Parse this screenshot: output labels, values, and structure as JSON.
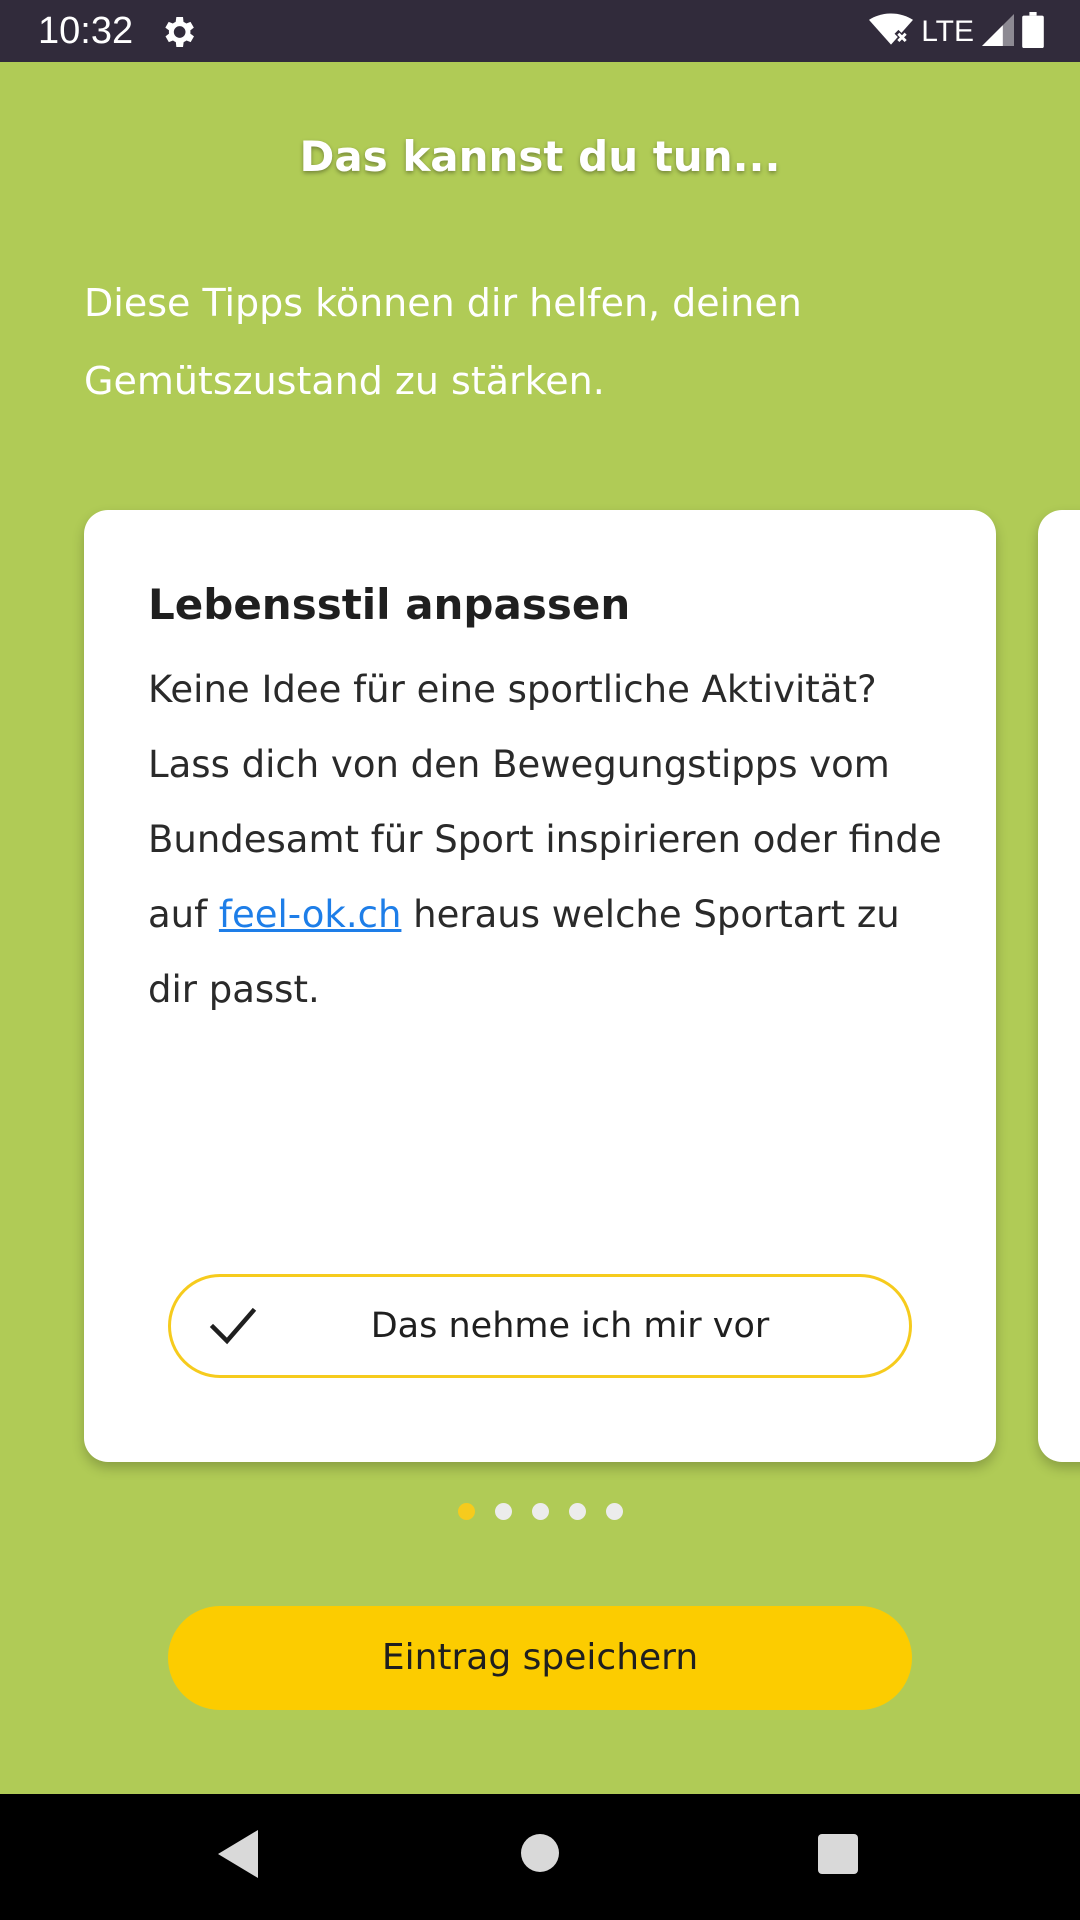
{
  "status_bar": {
    "time": "10:32",
    "network": "LTE",
    "icons": [
      "gear-icon",
      "wifi-icon",
      "signal-icon",
      "battery-icon"
    ]
  },
  "screen": {
    "title": "Das kannst du tun...",
    "intro": "Diese Tipps können dir helfen, deinen Gemütszustand zu stärken."
  },
  "card": {
    "title": "Lebensstil anpassen",
    "body_before_link": "Keine Idee für eine sportliche Aktivität? Lass dich von den Bewegungstipps vom Bundesamt für Sport inspirieren oder finde auf ",
    "link_text": "feel-ok.ch",
    "body_after_link": " heraus welche Sportart zu dir passt.",
    "commit_button_label": "Das nehme ich mir vor",
    "commit_button_icon": "check-icon"
  },
  "pager": {
    "total_pages": 5,
    "current_page": 1
  },
  "save_button_label": "Eintrag speichern",
  "nav_bar": {
    "icons": [
      "back-icon",
      "home-icon",
      "recents-icon"
    ]
  },
  "colors": {
    "background": "#b0cb56",
    "status_bar": "#312b3b",
    "accent_yellow": "#fccc00",
    "link_blue": "#1e7ee8"
  }
}
